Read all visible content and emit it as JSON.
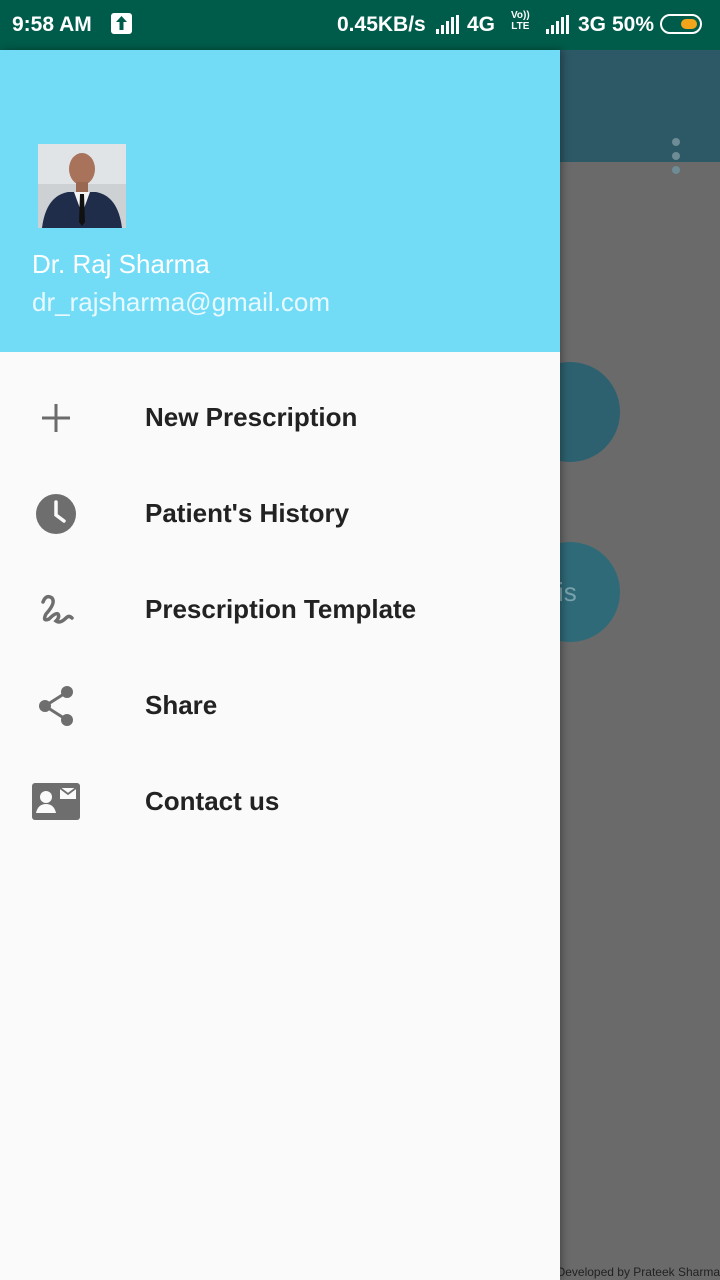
{
  "status_bar": {
    "time": "9:58 AM",
    "net_speed": "0.45KB/s",
    "network1": "4G",
    "volte": "Vo))\nLTE",
    "network2": "3G",
    "battery": "50%",
    "battery_color": "#f2a51a"
  },
  "drawer": {
    "header_color": "#72dcf7",
    "user_name": "Dr. Raj Sharma",
    "user_email": "dr_rajsharma@gmail.com",
    "items": [
      {
        "label": "New Prescription",
        "icon": "plus-icon"
      },
      {
        "label": "Patient's History",
        "icon": "clock-icon"
      },
      {
        "label": "Prescription Template",
        "icon": "signature-icon"
      },
      {
        "label": "Share",
        "icon": "share-icon"
      },
      {
        "label": "Contact us",
        "icon": "contact-card-icon"
      }
    ]
  },
  "background_app": {
    "toolbar_color": "#2d5865",
    "fab_partial_text": "is",
    "footer": "Developed by Prateek Sharma"
  }
}
